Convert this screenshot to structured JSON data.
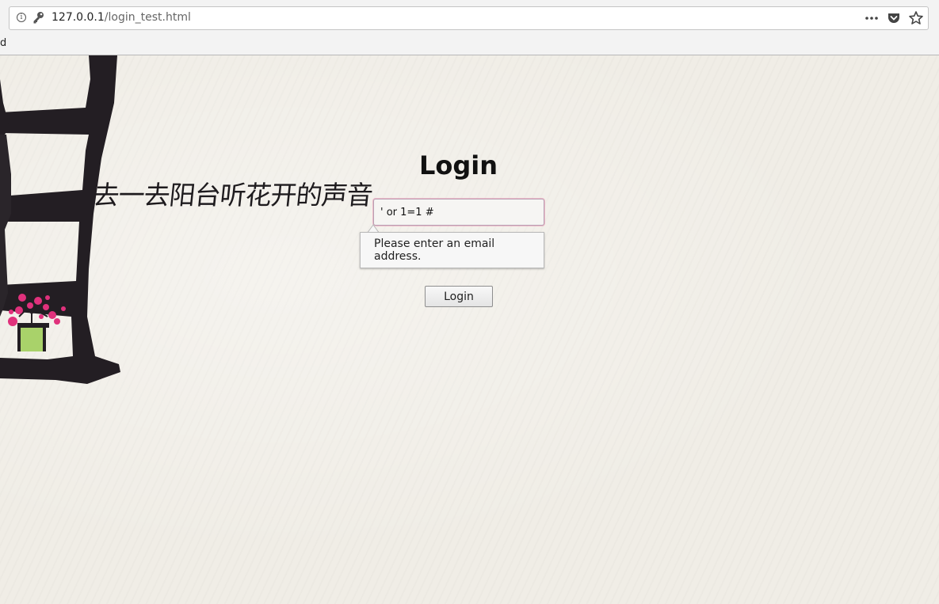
{
  "browser": {
    "url_host": "127.0.0.1",
    "url_path": "/login_test.html",
    "bookmark_fragment": "d",
    "icons": [
      "info-icon",
      "key-icon",
      "more-icon",
      "pocket-icon",
      "bookmark-star-icon"
    ]
  },
  "page": {
    "calligraphy_text": "去一去阳台听花开的声音",
    "title": "Login",
    "email_input_value": "' or 1=1 #",
    "validation_message": "Please enter an email address.",
    "login_button_label": "Login"
  },
  "colors": {
    "page_background": "#f0ede6",
    "flower_pink": "#e0317c",
    "pot_green": "#a9d26a",
    "ink": "#1e1b1e"
  }
}
